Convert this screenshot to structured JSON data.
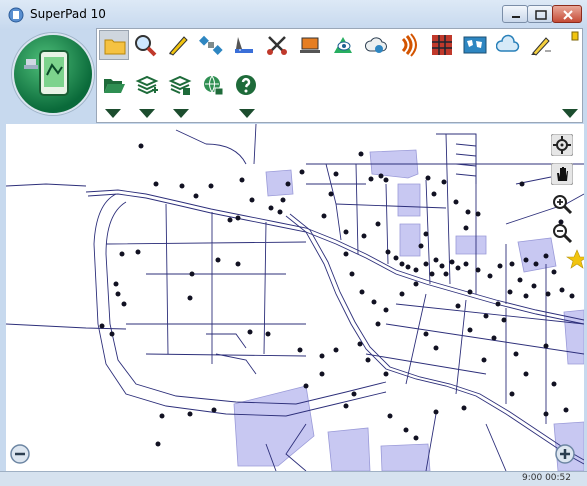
{
  "window": {
    "title": "SuperPad 10",
    "buttons": [
      "minimize-button",
      "maximize-button",
      "close-button"
    ]
  },
  "toolbar": {
    "row1_icons": [
      "folder-icon",
      "magnifier-icon",
      "pen-icon",
      "satellite-icon",
      "ruler-icon",
      "scissors-icon",
      "laptop-icon",
      "eye-layer-icon",
      "cloud-sync-icon",
      "signal-icon",
      "grid-icon",
      "world-map-icon",
      "cloud-icon",
      "pencil-icon"
    ],
    "row2_icons": [
      "open-folder-icon",
      "layers-add-icon",
      "layers-edit-icon",
      "globe-lock-icon",
      "help-icon"
    ],
    "selected_tool": "folder-icon"
  },
  "map_controls": [
    "locate-icon",
    "pan-hand-icon",
    "zoom-in-icon",
    "zoom-out-icon",
    "zoom-minus-button",
    "zoom-plus-button"
  ],
  "status": {
    "clock": "9:00 00:52"
  },
  "colors": {
    "road": "#2d2f7a",
    "poi": "#111122",
    "area_fill": "#c8c8f2",
    "titlebar": "#c6d8ee",
    "dropdown_arrow": "#1c4d2e"
  }
}
